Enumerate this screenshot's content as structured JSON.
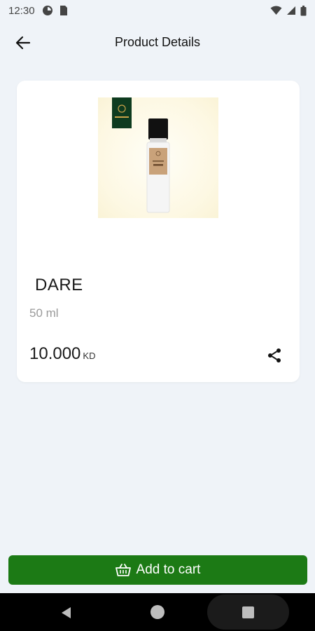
{
  "status_bar": {
    "time": "12:30",
    "left_icons": [
      "data-saver-icon",
      "sim-card-icon"
    ],
    "right_icons": [
      "wifi-icon",
      "signal-icon",
      "battery-icon"
    ]
  },
  "header": {
    "title": "Product Details",
    "back_icon": "arrow-left-icon"
  },
  "product": {
    "name": "DARE",
    "size": "50 ml",
    "price": "10.000",
    "currency": "KD",
    "image_colors": {
      "background": "#fdf8e3",
      "box": "#0e3b1f",
      "label": "#c9a27a",
      "cap": "#111111"
    },
    "share_icon": "share-icon"
  },
  "cart_button": {
    "label": "Add to cart",
    "icon": "basket-icon",
    "color": "#1c7a15"
  },
  "nav_bar": {
    "items": [
      "nav-back-icon",
      "nav-home-icon",
      "nav-recents-icon"
    ]
  }
}
